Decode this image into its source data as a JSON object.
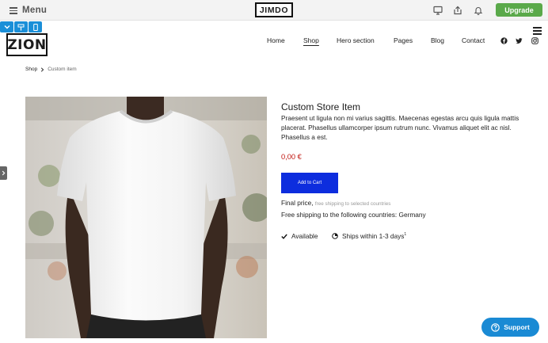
{
  "topbar": {
    "menu_label": "Menu",
    "brand": "JIMDO",
    "icons": [
      "desktop-icon",
      "share-icon",
      "bell-icon"
    ],
    "upgrade_label": "Upgrade",
    "upgrade_color": "#5aa94a"
  },
  "viewbar": {
    "icons": [
      "chevron-down-icon",
      "paint-brush-icon",
      "mobile-icon"
    ],
    "color": "#1a8fd8"
  },
  "site": {
    "logo": "ZION",
    "nav": [
      {
        "label": "Home"
      },
      {
        "label": "Shop"
      },
      {
        "label": "Hero section"
      },
      {
        "label": "Pages"
      },
      {
        "label": "Blog"
      },
      {
        "label": "Contact"
      }
    ],
    "active_nav": "Shop",
    "social_icons": [
      "facebook-icon",
      "twitter-icon",
      "instagram-icon"
    ]
  },
  "breadcrumb": {
    "home": "Shop",
    "current": "Custom item"
  },
  "product": {
    "title": "Custom Store Item",
    "description": "Praesent ut ligula non mi varius sagittis. Maecenas egestas arcu quis ligula mattis placerat. Phasellus ullamcorper ipsum rutrum nunc. Vivamus aliquet elit ac nisl. Phasellus a est.",
    "price": "0,00 €",
    "price_color": "#c0140e",
    "add_to_cart": "Add to Cart",
    "button_color": "#0d2dde",
    "final_price": "Final price,",
    "shipping_link": "free shipping to selected countries",
    "shipping_countries": "Free shipping to the following countries: Germany",
    "availability": "Available",
    "shipping_time": "Ships within 1-3 days",
    "shipping_footnote": "1"
  },
  "support": {
    "label": "Support",
    "color": "#1a8ad4"
  }
}
